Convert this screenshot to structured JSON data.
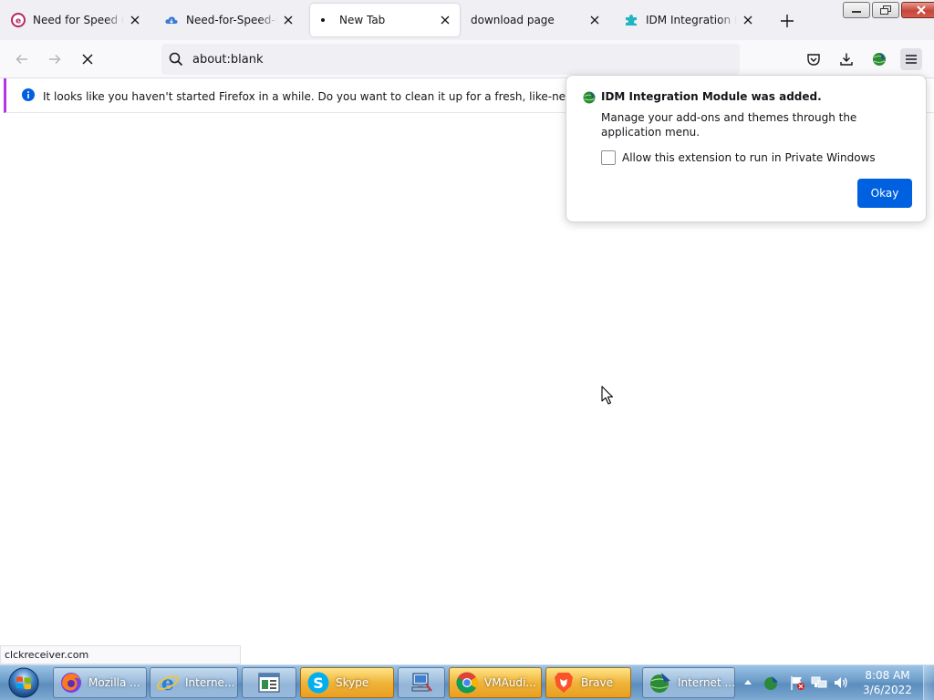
{
  "tabs": [
    {
      "title": "Need for Speed Carbon",
      "icon": "nfs-favicon-icon",
      "color": "#b5285e"
    },
    {
      "title": "Need-for-Speed-Carbon",
      "icon": "cloud-favicon-icon",
      "color": "#3a7bd5"
    },
    {
      "title": "New Tab",
      "icon": "loading-dot-icon",
      "selected": true
    },
    {
      "title": "download page",
      "icon": ""
    },
    {
      "title": "IDM Integration Module",
      "icon": "idm-puzzle-icon",
      "color": "#1fb6c1"
    }
  ],
  "urlbar": {
    "value": "about:blank"
  },
  "notification": {
    "text": "It looks like you haven't started Firefox in a while. Do you want to clean it up for a fresh, like-new experience? A"
  },
  "popup": {
    "title": "IDM Integration Module was added.",
    "description": "Manage your add-ons and themes through the application menu.",
    "checkbox_label": "Allow this extension to run in Private Windows",
    "checkbox_checked": false,
    "okay_label": "Okay",
    "accent": "#0061e0"
  },
  "status": {
    "text": "clckreceiver.com"
  },
  "taskbar": {
    "tasks": [
      {
        "label": "Mozilla ...",
        "icon": "firefox-icon",
        "style": "blue"
      },
      {
        "label": "Interne...",
        "icon": "internet-explorer-icon",
        "style": "blue"
      },
      {
        "label": "",
        "icon": "document-window-icon",
        "style": "blue"
      },
      {
        "label": "Skype",
        "icon": "skype-icon",
        "style": "orange"
      },
      {
        "label": "",
        "icon": "network-computer-icon",
        "style": "blue"
      },
      {
        "label": "VMAudi...",
        "icon": "chrome-icon",
        "style": "orange"
      },
      {
        "label": "Brave",
        "icon": "brave-icon",
        "style": "orange"
      },
      {
        "label": "Internet ...",
        "icon": "idm-globe-icon",
        "style": "blue"
      }
    ],
    "clock": {
      "time": "8:08 AM",
      "date": "3/6/2022"
    }
  }
}
